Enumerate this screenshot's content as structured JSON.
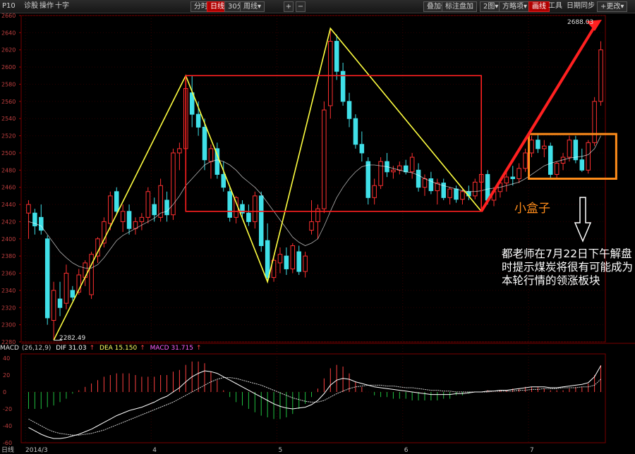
{
  "toolbar": {
    "code": "P10",
    "left_items": [
      "诊股",
      "操作",
      "十字"
    ],
    "period_buttons": [
      "分时",
      "日线",
      "30分",
      "周线▾"
    ],
    "active_period": "日线",
    "zoom_in": "+",
    "zoom_out": "−",
    "right_items": [
      "叠加▾",
      "标注盘加",
      "2图▾",
      "方略项▾",
      "画线",
      "工具",
      "日期同步",
      "+更改▾"
    ]
  },
  "colors": {
    "up": "#ff3030",
    "down": "#40e0e8",
    "box": "#ff2020",
    "zigzag": "#ffff40",
    "arrow": "#ff2020",
    "small_box": "#ff8c1a",
    "ma": "#ffffff",
    "macd_dif": "#ffffff",
    "macd_dea": "#ffffff"
  },
  "annotations": {
    "small_box_label": "小盒子",
    "note": "都老师在7月22日下午解盘时提示煤炭将很有可能成为本轮行情的领涨板块",
    "low_price_label": "2282.49",
    "high_price_label": "2688.03"
  },
  "macd_header": {
    "name": "MACD",
    "params": "(26,12,9)",
    "dif": "DIF 31.03",
    "dea": "DEA 15.150",
    "macd": "MACD 31.715"
  },
  "bottom_bar": {
    "left": "日线",
    "start": "2014/3"
  },
  "chart_data": {
    "type": "candlestick",
    "price_axis": {
      "range": [
        2280,
        2660
      ],
      "ticks": [
        2280,
        2300,
        2320,
        2340,
        2360,
        2380,
        2400,
        2420,
        2440,
        2460,
        2480,
        2500,
        2520,
        2540,
        2560,
        2580,
        2600,
        2620,
        2640,
        2660
      ]
    },
    "macd_axis": {
      "range": [
        -60,
        45
      ],
      "ticks": [
        -60,
        -40,
        -20,
        0,
        20,
        40
      ]
    },
    "time_labels": [
      "2014/3",
      "4",
      "5",
      "6",
      "7"
    ],
    "time_label_index": [
      0,
      20,
      40,
      60,
      80
    ],
    "candles": [
      {
        "o": 2430,
        "h": 2445,
        "l": 2400,
        "c": 2440
      },
      {
        "o": 2430,
        "h": 2435,
        "l": 2405,
        "c": 2415
      },
      {
        "o": 2425,
        "h": 2440,
        "l": 2405,
        "c": 2410
      },
      {
        "o": 2400,
        "h": 2404,
        "l": 2300,
        "c": 2308
      },
      {
        "o": 2305,
        "h": 2350,
        "l": 2282,
        "c": 2340
      },
      {
        "o": 2330,
        "h": 2350,
        "l": 2310,
        "c": 2320
      },
      {
        "o": 2325,
        "h": 2370,
        "l": 2318,
        "c": 2360
      },
      {
        "o": 2340,
        "h": 2345,
        "l": 2328,
        "c": 2332
      },
      {
        "o": 2338,
        "h": 2365,
        "l": 2335,
        "c": 2358
      },
      {
        "o": 2355,
        "h": 2375,
        "l": 2345,
        "c": 2372
      },
      {
        "o": 2335,
        "h": 2385,
        "l": 2330,
        "c": 2382
      },
      {
        "o": 2380,
        "h": 2402,
        "l": 2372,
        "c": 2400
      },
      {
        "o": 2395,
        "h": 2425,
        "l": 2390,
        "c": 2420
      },
      {
        "o": 2418,
        "h": 2455,
        "l": 2410,
        "c": 2450
      },
      {
        "o": 2455,
        "h": 2460,
        "l": 2428,
        "c": 2432
      },
      {
        "o": 2420,
        "h": 2440,
        "l": 2408,
        "c": 2432
      },
      {
        "o": 2432,
        "h": 2440,
        "l": 2405,
        "c": 2412
      },
      {
        "o": 2412,
        "h": 2425,
        "l": 2405,
        "c": 2420
      },
      {
        "o": 2420,
        "h": 2430,
        "l": 2410,
        "c": 2425
      },
      {
        "o": 2425,
        "h": 2460,
        "l": 2418,
        "c": 2455
      },
      {
        "o": 2440,
        "h": 2448,
        "l": 2420,
        "c": 2428
      },
      {
        "o": 2425,
        "h": 2470,
        "l": 2420,
        "c": 2462
      },
      {
        "o": 2445,
        "h": 2455,
        "l": 2420,
        "c": 2428
      },
      {
        "o": 2428,
        "h": 2505,
        "l": 2422,
        "c": 2500
      },
      {
        "o": 2500,
        "h": 2512,
        "l": 2480,
        "c": 2505
      },
      {
        "o": 2505,
        "h": 2580,
        "l": 2500,
        "c": 2575
      },
      {
        "o": 2570,
        "h": 2590,
        "l": 2530,
        "c": 2545
      },
      {
        "o": 2545,
        "h": 2560,
        "l": 2520,
        "c": 2530
      },
      {
        "o": 2530,
        "h": 2540,
        "l": 2480,
        "c": 2492
      },
      {
        "o": 2490,
        "h": 2510,
        "l": 2470,
        "c": 2505
      },
      {
        "o": 2505,
        "h": 2512,
        "l": 2470,
        "c": 2475
      },
      {
        "o": 2475,
        "h": 2490,
        "l": 2455,
        "c": 2460
      },
      {
        "o": 2455,
        "h": 2460,
        "l": 2420,
        "c": 2425
      },
      {
        "o": 2425,
        "h": 2450,
        "l": 2418,
        "c": 2448
      },
      {
        "o": 2440,
        "h": 2445,
        "l": 2425,
        "c": 2430
      },
      {
        "o": 2430,
        "h": 2440,
        "l": 2415,
        "c": 2420
      },
      {
        "o": 2420,
        "h": 2455,
        "l": 2412,
        "c": 2450
      },
      {
        "o": 2450,
        "h": 2455,
        "l": 2385,
        "c": 2392
      },
      {
        "o": 2398,
        "h": 2418,
        "l": 2350,
        "c": 2355
      },
      {
        "o": 2355,
        "h": 2378,
        "l": 2350,
        "c": 2375
      },
      {
        "o": 2372,
        "h": 2390,
        "l": 2360,
        "c": 2382
      },
      {
        "o": 2380,
        "h": 2390,
        "l": 2358,
        "c": 2365
      },
      {
        "o": 2365,
        "h": 2395,
        "l": 2360,
        "c": 2392
      },
      {
        "o": 2385,
        "h": 2392,
        "l": 2358,
        "c": 2362
      },
      {
        "o": 2362,
        "h": 2385,
        "l": 2355,
        "c": 2380
      },
      {
        "o": 2410,
        "h": 2445,
        "l": 2405,
        "c": 2420
      },
      {
        "o": 2420,
        "h": 2440,
        "l": 2400,
        "c": 2435
      },
      {
        "o": 2435,
        "h": 2560,
        "l": 2430,
        "c": 2550
      },
      {
        "o": 2555,
        "h": 2645,
        "l": 2540,
        "c": 2630
      },
      {
        "o": 2630,
        "h": 2638,
        "l": 2585,
        "c": 2595
      },
      {
        "o": 2595,
        "h": 2605,
        "l": 2555,
        "c": 2560
      },
      {
        "o": 2560,
        "h": 2570,
        "l": 2530,
        "c": 2540
      },
      {
        "o": 2540,
        "h": 2545,
        "l": 2505,
        "c": 2510
      },
      {
        "o": 2510,
        "h": 2525,
        "l": 2490,
        "c": 2500
      },
      {
        "o": 2490,
        "h": 2495,
        "l": 2440,
        "c": 2448
      },
      {
        "o": 2448,
        "h": 2470,
        "l": 2440,
        "c": 2462
      },
      {
        "o": 2462,
        "h": 2495,
        "l": 2458,
        "c": 2490
      },
      {
        "o": 2490,
        "h": 2500,
        "l": 2472,
        "c": 2478
      },
      {
        "o": 2478,
        "h": 2485,
        "l": 2470,
        "c": 2480
      },
      {
        "o": 2480,
        "h": 2490,
        "l": 2475,
        "c": 2485
      },
      {
        "o": 2485,
        "h": 2492,
        "l": 2475,
        "c": 2478
      },
      {
        "o": 2478,
        "h": 2500,
        "l": 2470,
        "c": 2495
      },
      {
        "o": 2480,
        "h": 2488,
        "l": 2455,
        "c": 2460
      },
      {
        "o": 2460,
        "h": 2475,
        "l": 2450,
        "c": 2470
      },
      {
        "o": 2470,
        "h": 2478,
        "l": 2452,
        "c": 2456
      },
      {
        "o": 2456,
        "h": 2470,
        "l": 2440,
        "c": 2465
      },
      {
        "o": 2465,
        "h": 2470,
        "l": 2445,
        "c": 2448
      },
      {
        "o": 2448,
        "h": 2460,
        "l": 2440,
        "c": 2458
      },
      {
        "o": 2458,
        "h": 2462,
        "l": 2442,
        "c": 2446
      },
      {
        "o": 2446,
        "h": 2458,
        "l": 2440,
        "c": 2455
      },
      {
        "o": 2455,
        "h": 2462,
        "l": 2445,
        "c": 2450
      },
      {
        "o": 2450,
        "h": 2470,
        "l": 2446,
        "c": 2466
      },
      {
        "o": 2466,
        "h": 2478,
        "l": 2455,
        "c": 2475
      },
      {
        "o": 2475,
        "h": 2480,
        "l": 2440,
        "c": 2445
      },
      {
        "o": 2445,
        "h": 2460,
        "l": 2438,
        "c": 2455
      },
      {
        "o": 2455,
        "h": 2470,
        "l": 2448,
        "c": 2465
      },
      {
        "o": 2465,
        "h": 2478,
        "l": 2455,
        "c": 2472
      },
      {
        "o": 2472,
        "h": 2485,
        "l": 2462,
        "c": 2470
      },
      {
        "o": 2470,
        "h": 2488,
        "l": 2465,
        "c": 2482
      },
      {
        "o": 2482,
        "h": 2505,
        "l": 2478,
        "c": 2500
      },
      {
        "o": 2500,
        "h": 2520,
        "l": 2495,
        "c": 2515
      },
      {
        "o": 2515,
        "h": 2522,
        "l": 2500,
        "c": 2505
      },
      {
        "o": 2505,
        "h": 2515,
        "l": 2495,
        "c": 2508
      },
      {
        "o": 2508,
        "h": 2512,
        "l": 2470,
        "c": 2475
      },
      {
        "o": 2475,
        "h": 2490,
        "l": 2470,
        "c": 2488
      },
      {
        "o": 2488,
        "h": 2500,
        "l": 2480,
        "c": 2495
      },
      {
        "o": 2495,
        "h": 2520,
        "l": 2490,
        "c": 2515
      },
      {
        "o": 2515,
        "h": 2520,
        "l": 2488,
        "c": 2492
      },
      {
        "o": 2492,
        "h": 2505,
        "l": 2478,
        "c": 2480
      },
      {
        "o": 2480,
        "h": 2515,
        "l": 2476,
        "c": 2512
      },
      {
        "o": 2512,
        "h": 2565,
        "l": 2508,
        "c": 2560
      },
      {
        "o": 2560,
        "h": 2630,
        "l": 2555,
        "c": 2620
      }
    ],
    "ma_line": [
      2420,
      2418,
      2415,
      2405,
      2395,
      2385,
      2378,
      2372,
      2368,
      2366,
      2366,
      2370,
      2378,
      2388,
      2398,
      2404,
      2408,
      2412,
      2416,
      2420,
      2424,
      2430,
      2432,
      2440,
      2450,
      2462,
      2470,
      2478,
      2486,
      2490,
      2492,
      2490,
      2486,
      2480,
      2472,
      2466,
      2460,
      2452,
      2442,
      2432,
      2422,
      2412,
      2402,
      2396,
      2392,
      2395,
      2400,
      2415,
      2432,
      2448,
      2460,
      2470,
      2478,
      2484,
      2486,
      2486,
      2485,
      2484,
      2482,
      2480,
      2478,
      2477,
      2474,
      2470,
      2467,
      2464,
      2462,
      2460,
      2458,
      2456,
      2455,
      2455,
      2456,
      2458,
      2459,
      2460,
      2462,
      2464,
      2466,
      2470,
      2475,
      2480,
      2485,
      2488,
      2490,
      2492,
      2494,
      2495,
      2496,
      2498,
      2505,
      2520
    ],
    "macd": {
      "dif": [
        -42,
        -46,
        -50,
        -53,
        -55,
        -55,
        -54,
        -52,
        -50,
        -47,
        -44,
        -40,
        -36,
        -32,
        -28,
        -25,
        -22,
        -20,
        -18,
        -15,
        -12,
        -8,
        -5,
        0,
        5,
        12,
        18,
        22,
        25,
        24,
        22,
        18,
        14,
        10,
        6,
        2,
        -2,
        -6,
        -10,
        -14,
        -17,
        -19,
        -20,
        -19,
        -18,
        -15,
        -10,
        -2,
        8,
        14,
        16,
        15,
        12,
        10,
        8,
        6,
        5,
        4,
        3,
        2,
        1,
        0,
        -1,
        -2,
        -3,
        -3,
        -3,
        -3,
        -2,
        -2,
        -1,
        0,
        0,
        1,
        1,
        2,
        2,
        3,
        4,
        5,
        6,
        6,
        6,
        5,
        5,
        6,
        7,
        8,
        9,
        11,
        18,
        31
      ],
      "dea": [
        -32,
        -36,
        -40,
        -44,
        -47,
        -49,
        -50,
        -51,
        -51,
        -50,
        -49,
        -47,
        -45,
        -42,
        -39,
        -36,
        -33,
        -30,
        -27,
        -24,
        -21,
        -18,
        -15,
        -12,
        -8,
        -4,
        0,
        4,
        8,
        12,
        15,
        17,
        17,
        16,
        14,
        12,
        10,
        8,
        5,
        2,
        -1,
        -4,
        -7,
        -9,
        -11,
        -12,
        -12,
        -10,
        -6,
        -2,
        1,
        4,
        6,
        7,
        8,
        8,
        8,
        7,
        7,
        6,
        5,
        5,
        4,
        3,
        2,
        2,
        1,
        1,
        0,
        0,
        0,
        0,
        0,
        0,
        1,
        1,
        1,
        1,
        2,
        2,
        3,
        3,
        4,
        4,
        4,
        5,
        5,
        5,
        6,
        6,
        8,
        15.15
      ]
    }
  }
}
